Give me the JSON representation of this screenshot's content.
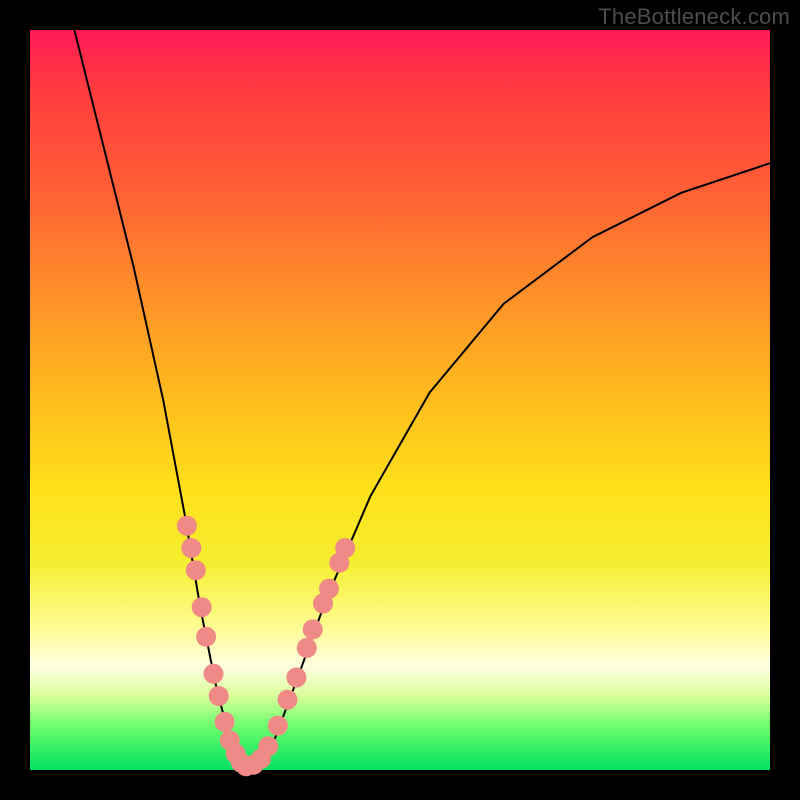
{
  "watermark": "TheBottleneck.com",
  "chart_data": {
    "type": "line",
    "title": "",
    "xlabel": "",
    "ylabel": "",
    "xlim": [
      0,
      100
    ],
    "ylim": [
      0,
      100
    ],
    "curve": {
      "left_branch": [
        {
          "x": 6,
          "y": 100
        },
        {
          "x": 10,
          "y": 84
        },
        {
          "x": 14,
          "y": 68
        },
        {
          "x": 18,
          "y": 50
        },
        {
          "x": 21,
          "y": 34
        },
        {
          "x": 23,
          "y": 22
        },
        {
          "x": 25,
          "y": 12
        },
        {
          "x": 26.5,
          "y": 6
        },
        {
          "x": 28,
          "y": 2
        },
        {
          "x": 29,
          "y": 0.5
        }
      ],
      "right_branch": [
        {
          "x": 29,
          "y": 0.5
        },
        {
          "x": 31,
          "y": 1
        },
        {
          "x": 33,
          "y": 4
        },
        {
          "x": 36,
          "y": 12
        },
        {
          "x": 40,
          "y": 23
        },
        {
          "x": 46,
          "y": 37
        },
        {
          "x": 54,
          "y": 51
        },
        {
          "x": 64,
          "y": 63
        },
        {
          "x": 76,
          "y": 72
        },
        {
          "x": 88,
          "y": 78
        },
        {
          "x": 100,
          "y": 82
        }
      ]
    },
    "dots": [
      {
        "x": 21.2,
        "y": 33
      },
      {
        "x": 21.8,
        "y": 30
      },
      {
        "x": 22.4,
        "y": 27
      },
      {
        "x": 23.2,
        "y": 22
      },
      {
        "x": 23.8,
        "y": 18
      },
      {
        "x": 24.8,
        "y": 13
      },
      {
        "x": 25.5,
        "y": 10
      },
      {
        "x": 26.3,
        "y": 6.5
      },
      {
        "x": 27.0,
        "y": 4
      },
      {
        "x": 27.8,
        "y": 2.2
      },
      {
        "x": 28.5,
        "y": 1.0
      },
      {
        "x": 29.2,
        "y": 0.5
      },
      {
        "x": 30.2,
        "y": 0.7
      },
      {
        "x": 31.2,
        "y": 1.5
      },
      {
        "x": 32.2,
        "y": 3.2
      },
      {
        "x": 33.5,
        "y": 6
      },
      {
        "x": 34.8,
        "y": 9.5
      },
      {
        "x": 36.0,
        "y": 12.5
      },
      {
        "x": 37.4,
        "y": 16.5
      },
      {
        "x": 38.2,
        "y": 19
      },
      {
        "x": 39.6,
        "y": 22.5
      },
      {
        "x": 40.4,
        "y": 24.5
      },
      {
        "x": 41.8,
        "y": 28
      },
      {
        "x": 42.6,
        "y": 30
      }
    ],
    "dot_radius": 10
  }
}
